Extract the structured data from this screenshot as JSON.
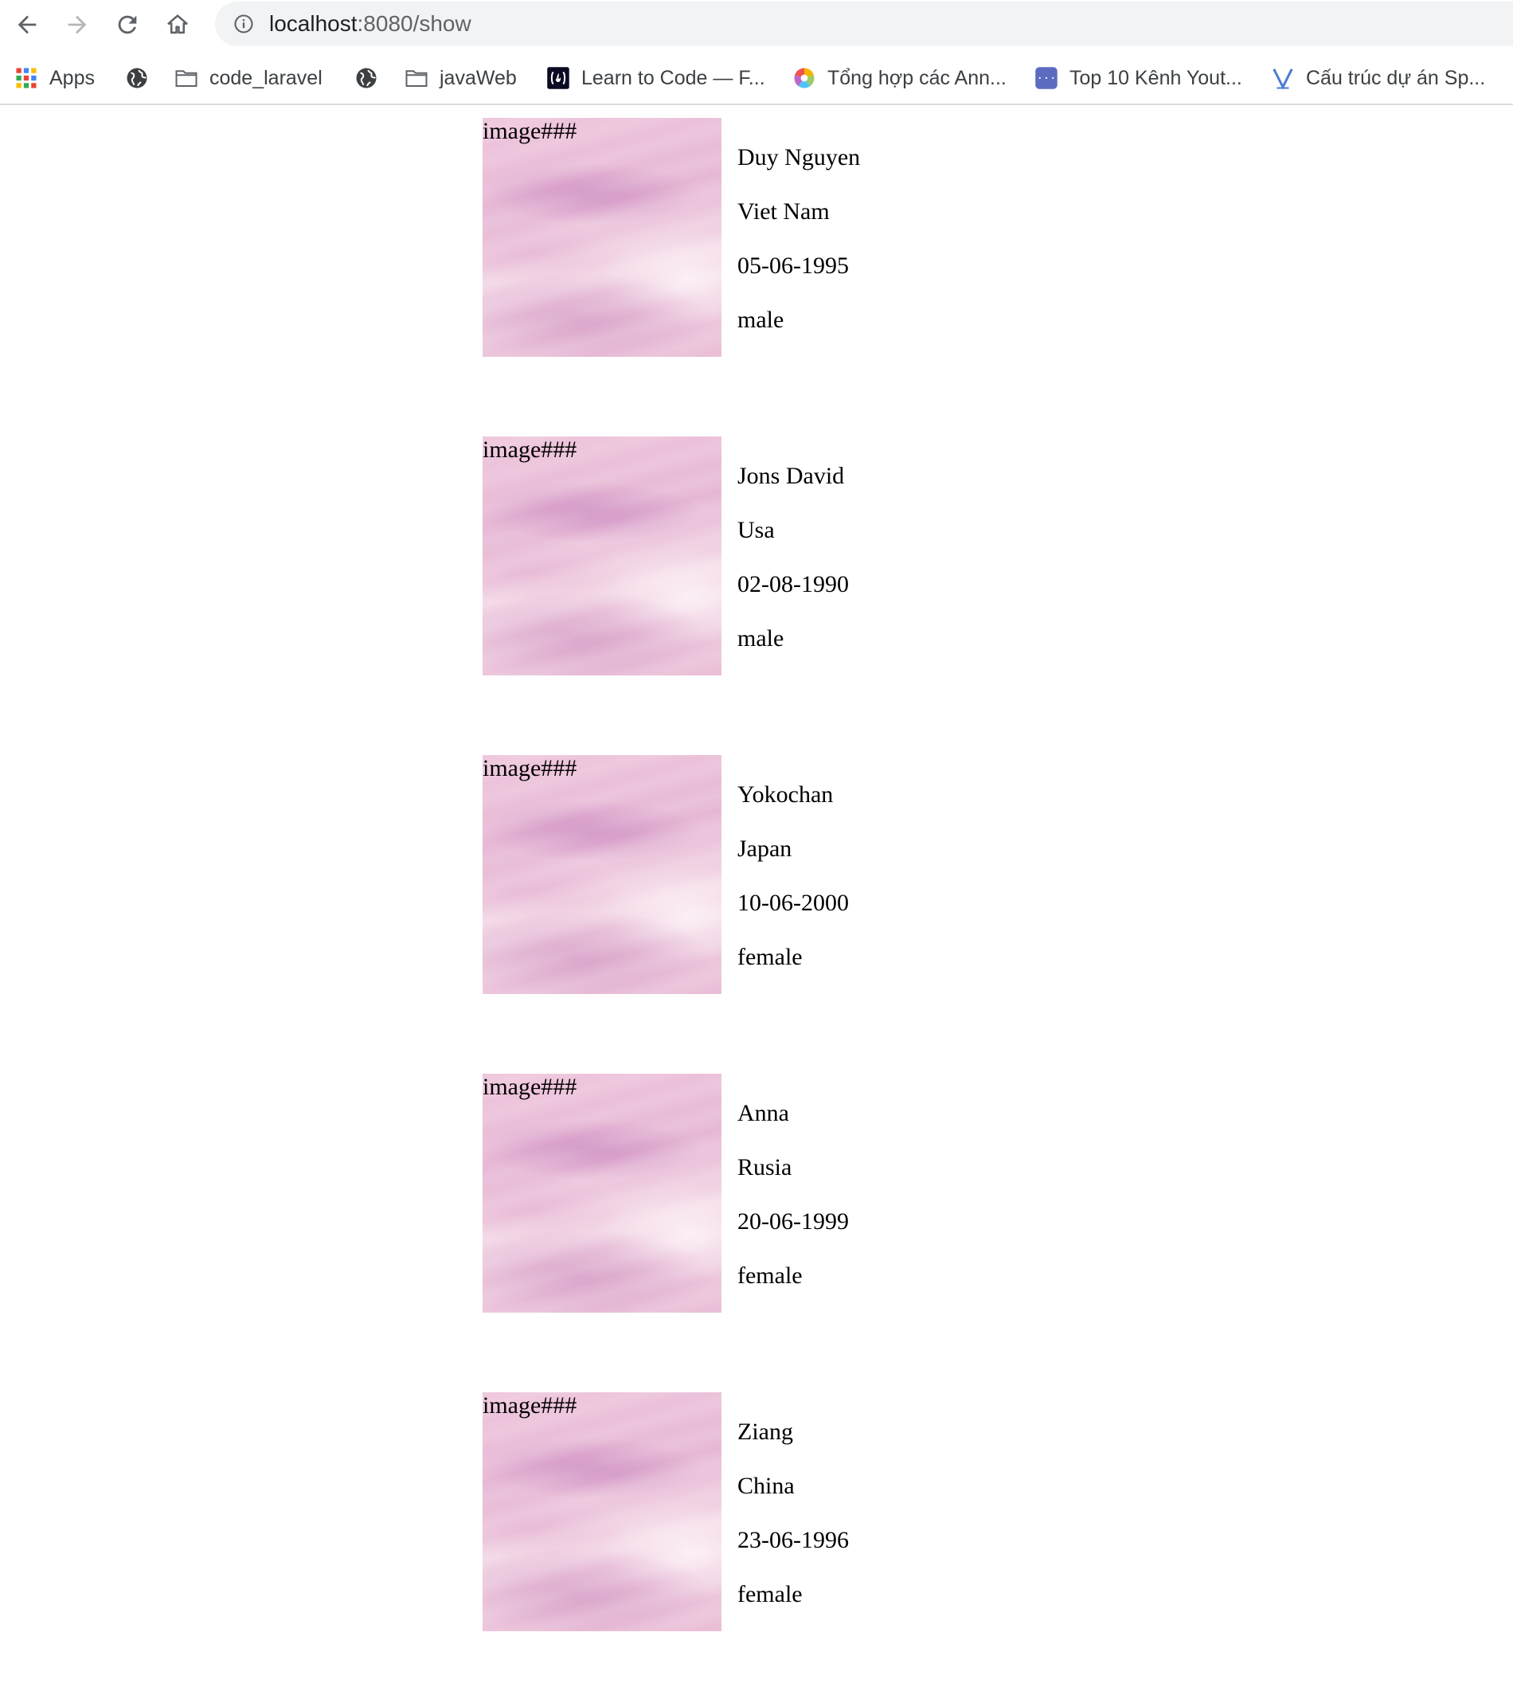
{
  "browser": {
    "url_host": "localhost",
    "url_rest": ":8080/show",
    "bookmarks": [
      {
        "label": "Apps",
        "icon": "apps-grid-icon"
      },
      {
        "label": "",
        "icon": "globe-icon"
      },
      {
        "label": "code_laravel",
        "icon": "folder-icon"
      },
      {
        "label": "",
        "icon": "globe-icon"
      },
      {
        "label": "javaWeb",
        "icon": "folder-icon"
      },
      {
        "label": "Learn to Code — F...",
        "icon": "freecodecamp-icon"
      },
      {
        "label": "Tổng hợp các Ann...",
        "icon": "color-wheel-icon"
      },
      {
        "label": "Top 10 Kênh Yout...",
        "icon": "braces-icon"
      },
      {
        "label": "Cấu trúc dự án Sp...",
        "icon": "v-logo-icon"
      }
    ]
  },
  "people": [
    {
      "image_alt": "image###",
      "name": "Duy Nguyen",
      "country": "Viet Nam",
      "dob": "05-06-1995",
      "gender": "male"
    },
    {
      "image_alt": "image###",
      "name": "Jons David",
      "country": "Usa",
      "dob": "02-08-1990",
      "gender": "male"
    },
    {
      "image_alt": "image###",
      "name": "Yokochan",
      "country": "Japan",
      "dob": "10-06-2000",
      "gender": "female"
    },
    {
      "image_alt": "image###",
      "name": "Anna",
      "country": "Rusia",
      "dob": "20-06-1999",
      "gender": "female"
    },
    {
      "image_alt": "image###",
      "name": "Ziang",
      "country": "China",
      "dob": "23-06-1996",
      "gender": "female"
    }
  ]
}
